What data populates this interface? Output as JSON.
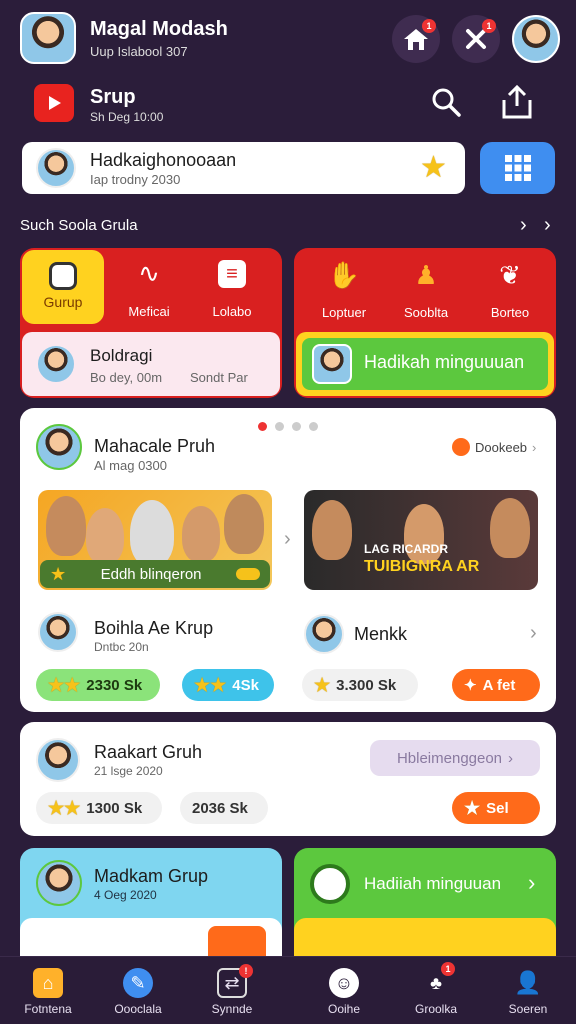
{
  "profile": {
    "name": "Magal Modash",
    "sub": "Uup Islabool 307"
  },
  "header": {
    "home_badge": "1",
    "tools_badge": "1"
  },
  "group_row": {
    "title": "Srup",
    "sub": "Sh Deg 10:00"
  },
  "search_card": {
    "title": "Hadkaighonooaan",
    "sub": "Iap trodny 2030"
  },
  "section": {
    "title": "Such Soola Grula"
  },
  "red_left": {
    "tabs": [
      "Gurup",
      "Meficai",
      "Lolabo"
    ],
    "card_title": "Boldragi",
    "card_sub": "Bo dey, 00m",
    "card_sub2": "Sondt Par"
  },
  "red_right": {
    "tabs": [
      "Loptuer",
      "Sooblta",
      "Borteo"
    ],
    "banner": "Hadikah minguuuan"
  },
  "feature": {
    "title": "Mahacale Pruh",
    "sub": "Al mag 0300",
    "link": "Dookeeb",
    "photo1_caption": "Eddh blinqeron",
    "photo2_text_line1": "LAG RICARDR",
    "photo2_text_line2": "TUIBIGNRA AR",
    "left_user": "Boihla Ae Krup",
    "left_user_sub": "Dntbc 20n",
    "right_user": "Menkk",
    "pill1": "2330 Sk",
    "pill2": "4Sk",
    "pill3": "3.300 Sk",
    "pill4": "A fet"
  },
  "second": {
    "title": "Raakart Gruh",
    "sub": "21 lsge 2020",
    "button": "Hbleimenggeon",
    "pill1": "1300 Sk",
    "pill2": "2036 Sk",
    "pill3": "Sel"
  },
  "bottom_left": {
    "title": "Madkam Grup",
    "sub": "4 Oeg 2020"
  },
  "bottom_right": {
    "title": "Hadiiah minguuan"
  },
  "nav": [
    "Fotntena",
    "Oooclala",
    "Synnde",
    "Ooihe",
    "Groolka",
    "Soeren"
  ],
  "colors": {
    "accent_blue": "#3f8ef0",
    "red": "#d92020",
    "green": "#5cc83e",
    "orange": "#ff6a1a"
  }
}
